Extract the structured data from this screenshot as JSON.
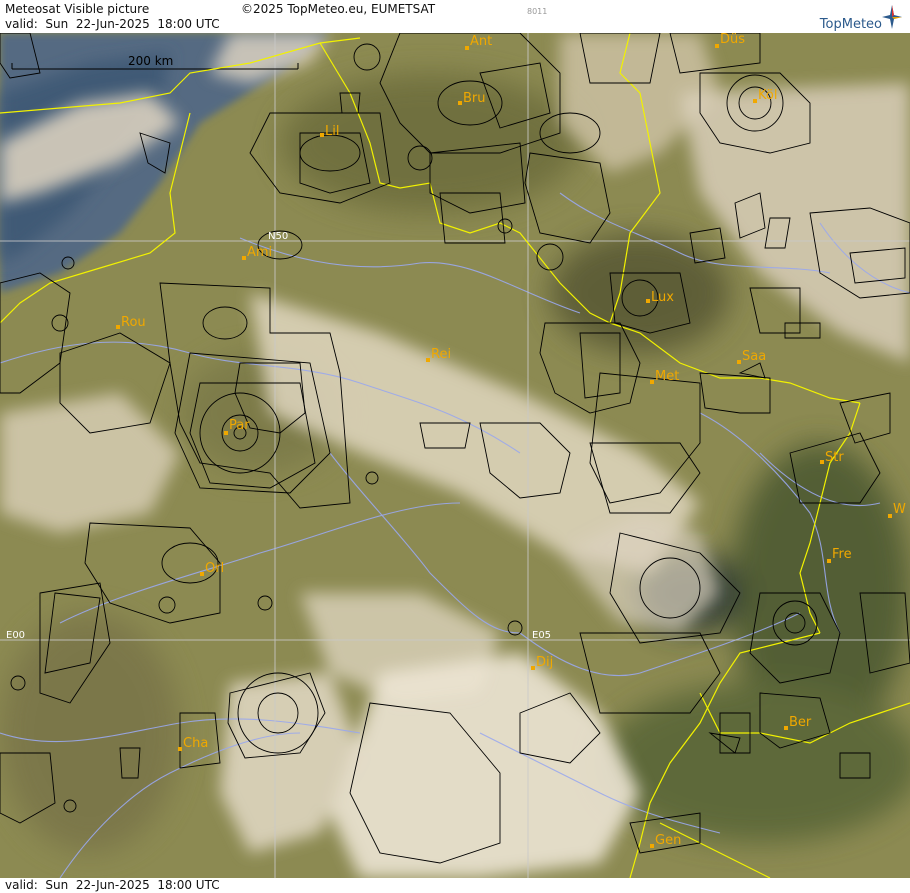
{
  "header": {
    "title": "Meteosat Visible picture",
    "valid": "valid:  Sun  22-Jun-2025  18:00 UTC",
    "copyright": "©2025 TopMeteo.eu, EUMETSAT",
    "code": "8011",
    "logo": "TopMeteo"
  },
  "footer": {
    "valid": "valid:  Sun  22-Jun-2025  18:00 UTC"
  },
  "map": {
    "scale_label": "200 km",
    "grid_labels": {
      "n50": "N50",
      "e00": "E00",
      "e05": "E05"
    },
    "cities": [
      {
        "id": "ant",
        "label": "Ant"
      },
      {
        "id": "dus",
        "label": "Düs"
      },
      {
        "id": "bru",
        "label": "Bru"
      },
      {
        "id": "kol",
        "label": "Köl"
      },
      {
        "id": "lil",
        "label": "Lil"
      },
      {
        "id": "ami",
        "label": "Ami"
      },
      {
        "id": "lux",
        "label": "Lux"
      },
      {
        "id": "rou",
        "label": "Rou"
      },
      {
        "id": "rei",
        "label": "Rei"
      },
      {
        "id": "saa",
        "label": "Saa"
      },
      {
        "id": "met",
        "label": "Met"
      },
      {
        "id": "par",
        "label": "Par"
      },
      {
        "id": "str",
        "label": "Str"
      },
      {
        "id": "w",
        "label": "W"
      },
      {
        "id": "fre",
        "label": "Fre"
      },
      {
        "id": "orl",
        "label": "Orl"
      },
      {
        "id": "dij",
        "label": "Dij"
      },
      {
        "id": "ber",
        "label": "Ber"
      },
      {
        "id": "cha",
        "label": "Cha"
      },
      {
        "id": "gen",
        "label": "Gen"
      }
    ],
    "colors": {
      "land": "#8c8a52",
      "cloud": "#e9dfc9",
      "border": "#f2f200",
      "river": "#9aa8ee",
      "airspace": "#000000",
      "city": "#f0a800"
    }
  }
}
